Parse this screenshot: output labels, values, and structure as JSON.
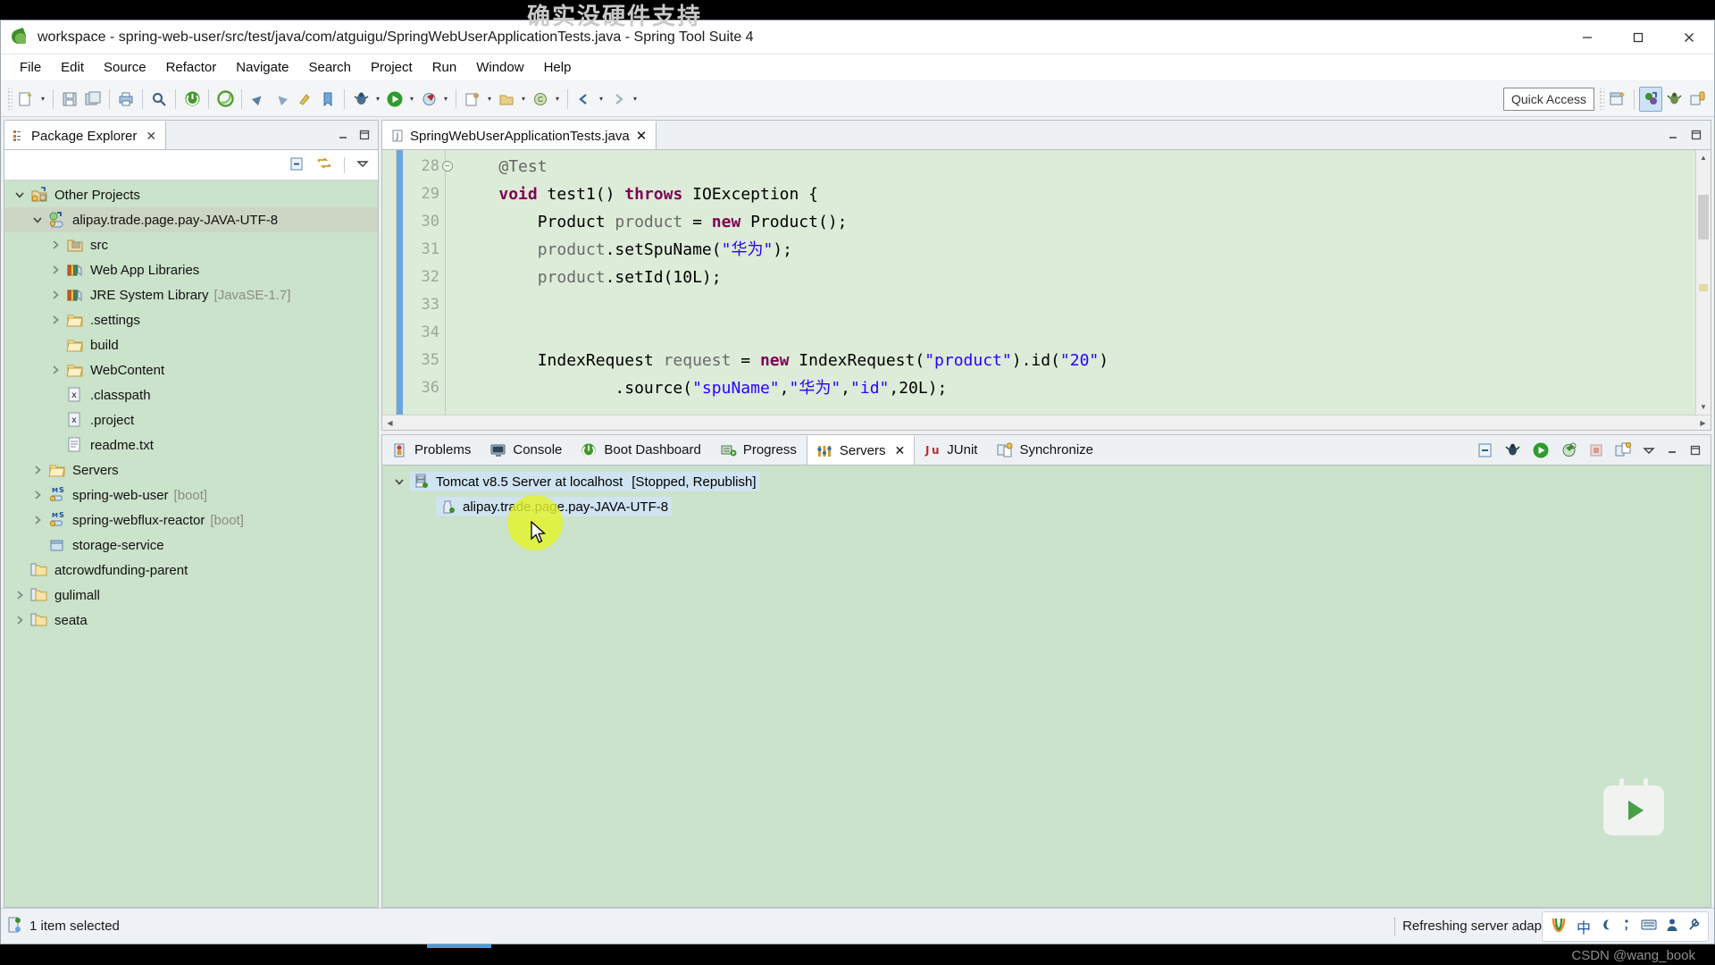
{
  "overlay": {
    "watermark_cn": "确实没硬件支持",
    "csdn_credit": "CSDN @wang_book"
  },
  "window": {
    "title": "workspace - spring-web-user/src/test/java/com/atguigu/SpringWebUserApplicationTests.java - Spring Tool Suite 4",
    "app_icon": "spring-leaf-icon",
    "controls": {
      "minimize": "–",
      "maximize": "☐",
      "close": "✕"
    }
  },
  "menubar": {
    "items": [
      "File",
      "Edit",
      "Source",
      "Refactor",
      "Navigate",
      "Search",
      "Project",
      "Run",
      "Window",
      "Help"
    ]
  },
  "toolbar": {
    "quick_access_placeholder": "Quick Access",
    "buttons": [
      "new-wizard-icon",
      "save-icon",
      "save-all-icon",
      "print-icon",
      "toggle-console-icon",
      "search-icon",
      "boot-dashboard-icon",
      "spring-icon",
      "next-annotation-icon",
      "previous-annotation-icon",
      "last-edit-location-icon",
      "back-icon",
      "forward-icon",
      "debug-icon",
      "run-icon",
      "external-tools-icon",
      "new-java-project-icon",
      "new-class-icon",
      "open-type-icon",
      "search-type-icon"
    ],
    "perspective_buttons": [
      "open-perspective-icon",
      "java-ee-perspective-icon",
      "debug-perspective-icon",
      "java-perspective-icon"
    ]
  },
  "package_explorer": {
    "tab_label": "Package Explorer",
    "close_label": "✕",
    "toolbar_icons": [
      "collapse-all-icon",
      "link-with-editor-icon",
      "view-menu-icon",
      "minimize-icon",
      "maximize-icon"
    ],
    "tree": [
      {
        "indent": 0,
        "twisty": "down",
        "icon": "java-projects-icon",
        "label": "Other Projects",
        "dim": "",
        "selected": false
      },
      {
        "indent": 1,
        "twisty": "down",
        "icon": "web-project-icon",
        "label": "alipay.trade.page.pay-JAVA-UTF-8",
        "dim": "",
        "selected": true
      },
      {
        "indent": 2,
        "twisty": "right",
        "icon": "source-folder-icon",
        "label": "src",
        "dim": "",
        "selected": false
      },
      {
        "indent": 2,
        "twisty": "right",
        "icon": "library-icon",
        "label": "Web App Libraries",
        "dim": "",
        "selected": false
      },
      {
        "indent": 2,
        "twisty": "right",
        "icon": "library-icon",
        "label": "JRE System Library",
        "dim": "[JavaSE-1.7]",
        "selected": false
      },
      {
        "indent": 2,
        "twisty": "right",
        "icon": "folder-icon",
        "label": ".settings",
        "dim": "",
        "selected": false
      },
      {
        "indent": 2,
        "twisty": "none",
        "icon": "folder-icon",
        "label": "build",
        "dim": "",
        "selected": false
      },
      {
        "indent": 2,
        "twisty": "right",
        "icon": "folder-icon",
        "label": "WebContent",
        "dim": "",
        "selected": false
      },
      {
        "indent": 2,
        "twisty": "none",
        "icon": "xml-file-icon",
        "label": ".classpath",
        "dim": "",
        "selected": false
      },
      {
        "indent": 2,
        "twisty": "none",
        "icon": "xml-file-icon",
        "label": ".project",
        "dim": "",
        "selected": false
      },
      {
        "indent": 2,
        "twisty": "none",
        "icon": "text-file-icon",
        "label": "readme.txt",
        "dim": "",
        "selected": false
      },
      {
        "indent": 1,
        "twisty": "right",
        "icon": "folder-icon",
        "label": "Servers",
        "dim": "",
        "selected": false
      },
      {
        "indent": 1,
        "twisty": "right",
        "icon": "spring-boot-icon",
        "label": "spring-web-user",
        "dim": "[boot]",
        "selected": false
      },
      {
        "indent": 1,
        "twisty": "right",
        "icon": "spring-boot-icon",
        "label": "spring-webflux-reactor",
        "dim": "[boot]",
        "selected": false
      },
      {
        "indent": 1,
        "twisty": "none",
        "icon": "closed-project-icon",
        "label": "storage-service",
        "dim": "",
        "selected": false
      },
      {
        "indent": 0,
        "twisty": "none",
        "icon": "maven-project-icon",
        "label": "atcrowdfunding-parent",
        "dim": "",
        "selected": false
      },
      {
        "indent": 0,
        "twisty": "right",
        "icon": "maven-project-icon",
        "label": "gulimall",
        "dim": "",
        "selected": false
      },
      {
        "indent": 0,
        "twisty": "right",
        "icon": "maven-project-icon",
        "label": "seata",
        "dim": "",
        "selected": false
      }
    ]
  },
  "editor": {
    "tab_label": "SpringWebUserApplicationTests.java",
    "tab_icon": "java-file-icon",
    "close_label": "✕",
    "toolbar_icons": [
      "minimize-icon",
      "maximize-icon"
    ],
    "lines": [
      {
        "num": "28",
        "fold": true,
        "tokens": [
          {
            "t": "    ",
            "c": "k-plain"
          },
          {
            "t": "@Test",
            "c": "k-ann"
          }
        ]
      },
      {
        "num": "29",
        "fold": false,
        "tokens": [
          {
            "t": "    ",
            "c": "k-plain"
          },
          {
            "t": "void",
            "c": "k-kw"
          },
          {
            "t": " test1() ",
            "c": "k-plain"
          },
          {
            "t": "throws",
            "c": "k-kw"
          },
          {
            "t": " IOException {",
            "c": "k-plain"
          }
        ]
      },
      {
        "num": "30",
        "fold": false,
        "tokens": [
          {
            "t": "        Product ",
            "c": "k-plain"
          },
          {
            "t": "product",
            "c": "k-fld"
          },
          {
            "t": " = ",
            "c": "k-plain"
          },
          {
            "t": "new",
            "c": "k-kw"
          },
          {
            "t": " Product();",
            "c": "k-plain"
          }
        ]
      },
      {
        "num": "31",
        "fold": false,
        "tokens": [
          {
            "t": "        ",
            "c": "k-plain"
          },
          {
            "t": "product",
            "c": "k-fld"
          },
          {
            "t": ".setSpuName(",
            "c": "k-plain"
          },
          {
            "t": "\"华为\"",
            "c": "k-str"
          },
          {
            "t": ");",
            "c": "k-plain"
          }
        ]
      },
      {
        "num": "32",
        "fold": false,
        "tokens": [
          {
            "t": "        ",
            "c": "k-plain"
          },
          {
            "t": "product",
            "c": "k-fld"
          },
          {
            "t": ".setId(10L);",
            "c": "k-plain"
          }
        ]
      },
      {
        "num": "33",
        "fold": false,
        "tokens": [
          {
            "t": "",
            "c": "k-plain"
          }
        ]
      },
      {
        "num": "34",
        "fold": false,
        "tokens": [
          {
            "t": "",
            "c": "k-plain"
          }
        ]
      },
      {
        "num": "35",
        "fold": false,
        "tokens": [
          {
            "t": "        IndexRequest ",
            "c": "k-plain"
          },
          {
            "t": "request",
            "c": "k-fld"
          },
          {
            "t": " = ",
            "c": "k-plain"
          },
          {
            "t": "new",
            "c": "k-kw"
          },
          {
            "t": " IndexRequest(",
            "c": "k-plain"
          },
          {
            "t": "\"product\"",
            "c": "k-str"
          },
          {
            "t": ").id(",
            "c": "k-plain"
          },
          {
            "t": "\"20\"",
            "c": "k-str"
          },
          {
            "t": ")",
            "c": "k-plain"
          }
        ]
      },
      {
        "num": "36",
        "fold": false,
        "tokens": [
          {
            "t": "                .source(",
            "c": "k-plain"
          },
          {
            "t": "\"spuName\"",
            "c": "k-str"
          },
          {
            "t": ",",
            "c": "k-plain"
          },
          {
            "t": "\"华为\"",
            "c": "k-str"
          },
          {
            "t": ",",
            "c": "k-plain"
          },
          {
            "t": "\"id\"",
            "c": "k-str"
          },
          {
            "t": ",20L);",
            "c": "k-plain"
          }
        ]
      }
    ]
  },
  "bottom_panel": {
    "tabs": [
      {
        "label": "Problems",
        "icon": "problems-icon",
        "active": false
      },
      {
        "label": "Console",
        "icon": "console-icon",
        "active": false
      },
      {
        "label": "Boot Dashboard",
        "icon": "boot-dashboard-icon",
        "active": false
      },
      {
        "label": "Progress",
        "icon": "progress-icon",
        "active": false
      },
      {
        "label": "Servers",
        "icon": "servers-icon",
        "active": true
      },
      {
        "label": "JUnit",
        "icon": "junit-icon",
        "active": false
      },
      {
        "label": "Synchronize",
        "icon": "synchronize-icon",
        "active": false
      }
    ],
    "active_tab_close": "✕",
    "toolbar_icons": [
      "collapse-all-icon",
      "debug-server-icon",
      "start-server-icon",
      "profile-server-icon",
      "stop-server-icon",
      "publish-icon",
      "view-menu-icon",
      "minimize-icon",
      "maximize-icon"
    ],
    "rows": [
      {
        "indent": 0,
        "twisty": "down",
        "icon": "tomcat-server-icon",
        "label": "Tomcat v8.5 Server at localhost",
        "status": "[Stopped, Republish]",
        "selected": true
      },
      {
        "indent": 1,
        "twisty": "none",
        "icon": "module-icon",
        "label": "alipay.trade.page.pay-JAVA-UTF-8",
        "status": "",
        "selected": true
      }
    ]
  },
  "statusbar": {
    "left_icon": "selection-icon",
    "left_text": "1 item selected",
    "right_text": "Refreshing server adap",
    "ime": {
      "logo": "sogou-icon",
      "mode": "中",
      "items": [
        "moon-icon",
        "comma-icon",
        "keyboard-icon",
        "person-icon",
        "tools-icon"
      ]
    }
  },
  "colors": {
    "editor_bg": "#dcecd8",
    "tree_bg": "#cbe2cb",
    "selection": "#cfe3f0",
    "accent": "#4a9ae0",
    "highlight": "#e3f32a"
  }
}
